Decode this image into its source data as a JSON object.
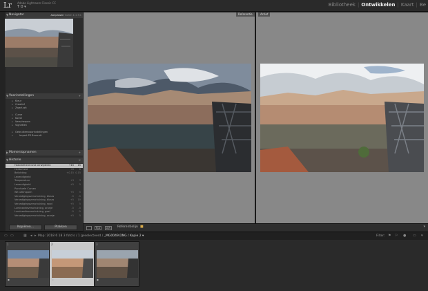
{
  "app": {
    "logo": "Lr",
    "name": "Adobe Lightroom Classic CC",
    "user": "T O ▾"
  },
  "modules": [
    "Bibliotheek",
    "Ontwikkelen",
    "Kaart",
    "Be"
  ],
  "active_module": "Ontwikkelen",
  "left_panel": {
    "navigator": {
      "title": "Navigator",
      "options": [
        "Aanpassen",
        "Vullen",
        "1:1",
        "3:1"
      ],
      "selected_option": "Aanpassen"
    },
    "presets": {
      "title": "Voorinstellingen",
      "items": [
        "Kleur",
        "Creatief",
        "Zwart-wit",
        "Curve",
        "Korrel",
        "Verscherpen",
        "Vignetten"
      ],
      "user_group": "Gebruikersvoorinstellingen",
      "user_item": "Import PS Bruendt"
    },
    "snapshots": {
      "title": "Momentopnamen"
    },
    "history": {
      "title": "Historie",
      "rows": [
        {
          "label": "Hoeveelheid rond verwijderen",
          "v1": "+15",
          "v2": "15",
          "selected": true
        },
        {
          "label": "Helderheid",
          "v1": "+8",
          "v2": "8"
        },
        {
          "label": "Belichting",
          "v1": "+0,15",
          "v2": "0,15"
        },
        {
          "label": "Levendigheid",
          "v1": "",
          "v2": ""
        },
        {
          "label": "Temperatuur",
          "v1": "+3",
          "v2": "3"
        },
        {
          "label": "Levendigheid",
          "v1": "+5",
          "v2": "5"
        },
        {
          "label": "Punctuele Curven",
          "v1": "",
          "v2": ""
        },
        {
          "label": "Wit uitknippen",
          "v1": "+5",
          "v2": "5"
        },
        {
          "label": "Verzadigingsverschuiving, blauw",
          "v1": "-5",
          "v2": "-5"
        },
        {
          "label": "Verzadigingsverschuiving, blauw",
          "v1": "+5",
          "v2": "10"
        },
        {
          "label": "Verzadigingsverschuiving, rood",
          "v1": "+5",
          "v2": "5"
        },
        {
          "label": "Luminantieverschuiving, oranje",
          "v1": "-5",
          "v2": "-5"
        },
        {
          "label": "Luminantieverschuiving, geel",
          "v1": "-5",
          "v2": "-5"
        },
        {
          "label": "Verzadigingsverschuiving, oranje",
          "v1": "+5",
          "v2": "5"
        }
      ]
    },
    "buttons": {
      "copy": "Kopiëren...",
      "paste": "Plakken"
    }
  },
  "views": {
    "reference": "Referentie",
    "active": "Actief"
  },
  "toolbar": {
    "reference_label": "Referentielijn",
    "btn_rv": "R|A",
    "btn_ar": "A|R"
  },
  "filmstrip_bar": {
    "prefix": "Map: 2018 6 18",
    "count": "3 foto's / 1 geselecteerd /",
    "filename": "_MG0049.DNG / Kopie 2 ▾",
    "filter_label": "Filter:"
  },
  "filmstrip": [
    {
      "num": "1",
      "selected": false,
      "sky": "#6f88a8",
      "land": "#6b5a4a"
    },
    {
      "num": "2",
      "selected": true,
      "sky": "#c7cfd8",
      "land": "#8a6b52"
    },
    {
      "num": "3",
      "selected": false,
      "sky": "#9aa4ae",
      "land": "#5e5044"
    }
  ],
  "colors": {
    "panel": "#2d2d2d",
    "canvas": "#888888",
    "accent_active": "#f0f0f0",
    "history_selected": "#bfbfbf"
  }
}
